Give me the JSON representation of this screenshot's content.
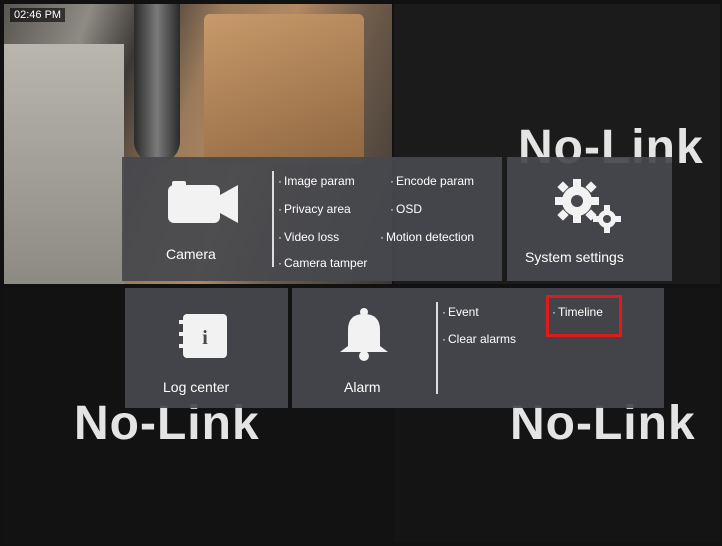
{
  "screen": {
    "timestamp": "02:46 PM",
    "no_link_label": "No-Link"
  },
  "menu": {
    "camera": {
      "label": "Camera",
      "options": [
        "Image param",
        "Encode param",
        "Privacy area",
        "OSD",
        "Video loss",
        "Motion detection",
        "Camera tamper"
      ]
    },
    "system_settings": {
      "label": "System settings"
    },
    "log_center": {
      "label": "Log center",
      "icon_letter": "i"
    },
    "alarm": {
      "label": "Alarm",
      "options": [
        "Event",
        "Timeline",
        "Clear alarms"
      ]
    }
  },
  "colors": {
    "tile_bg": "#46484e",
    "highlight": "#e01a1a"
  },
  "icons": [
    "camera-icon",
    "gear-icon",
    "notebook-icon",
    "bell-icon"
  ]
}
